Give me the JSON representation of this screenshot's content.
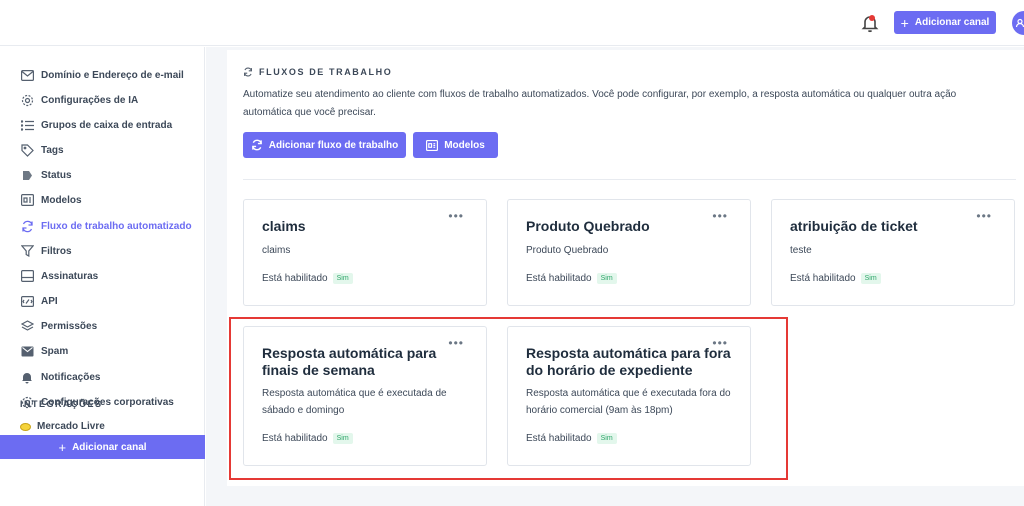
{
  "header": {
    "add_channel_label": "Adicionar canal"
  },
  "sidebar": {
    "items": [
      {
        "label": "Domínio e Endereço de e-mail",
        "icon": "mail-icon"
      },
      {
        "label": "Configurações de IA",
        "icon": "ai-settings-icon"
      },
      {
        "label": "Grupos de caixa de entrada",
        "icon": "list-icon"
      },
      {
        "label": "Tags",
        "icon": "tag-icon"
      },
      {
        "label": "Status",
        "icon": "status-icon"
      },
      {
        "label": "Modelos",
        "icon": "templates-icon"
      },
      {
        "label": "Fluxo de trabalho automatizado",
        "icon": "workflow-icon"
      },
      {
        "label": "Filtros",
        "icon": "filter-icon"
      },
      {
        "label": "Assinaturas",
        "icon": "signature-icon"
      },
      {
        "label": "API",
        "icon": "api-icon"
      },
      {
        "label": "Permissões",
        "icon": "permissions-icon"
      },
      {
        "label": "Spam",
        "icon": "spam-icon"
      },
      {
        "label": "Notificações",
        "icon": "bell-icon"
      },
      {
        "label": "Configurações corporativas",
        "icon": "gear-icon"
      }
    ],
    "integrations_title": "INTEGRAÇÕES",
    "integration_item": "Mercado Livre",
    "add_channel_label": "Adicionar canal"
  },
  "main": {
    "section_title": "FLUXOS DE TRABALHO",
    "description": "Automatize seu atendimento ao cliente com fluxos de trabalho automatizados. Você pode configurar, por exemplo, a resposta automática ou qualquer outra ação automática que você precisar.",
    "add_workflow_label": "Adicionar fluxo de trabalho",
    "templates_label": "Modelos",
    "cards": [
      {
        "title": "claims",
        "description": "claims",
        "status_label": "Está habilitado",
        "badge": "Sim"
      },
      {
        "title": "Produto Quebrado",
        "description": "Produto Quebrado",
        "status_label": "Está habilitado",
        "badge": "Sim"
      },
      {
        "title": "atribuição de ticket",
        "description": "teste",
        "status_label": "Está habilitado",
        "badge": "Sim"
      },
      {
        "title": "Resposta automática para finais de semana",
        "description": "Resposta automática que é executada de sábado e domingo",
        "status_label": "Está habilitado",
        "badge": "Sim"
      },
      {
        "title": "Resposta automática para fora do horário de expediente",
        "description": "Resposta automática que é executada fora do horário comercial (9am às 18pm)",
        "status_label": "Está habilitado",
        "badge": "Sim"
      }
    ]
  },
  "colors": {
    "accent": "#6c6cf2",
    "highlight": "#e53935",
    "badge_bg": "#e3f7ec",
    "badge_text": "#2fa66a"
  }
}
